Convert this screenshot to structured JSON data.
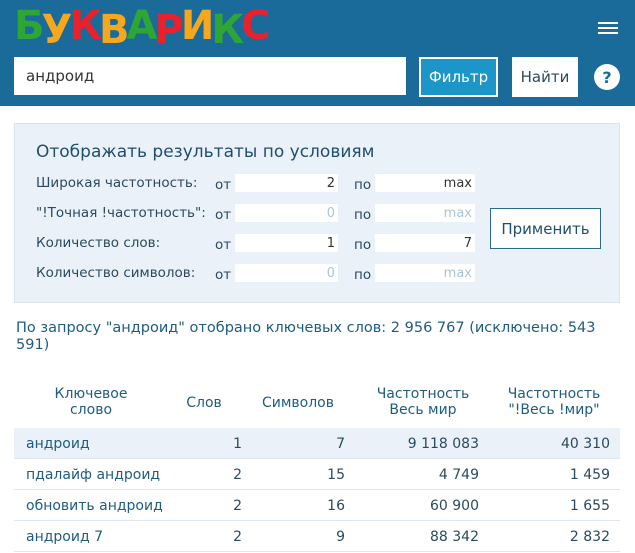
{
  "logo": {
    "letters": [
      "Б",
      "У",
      "К",
      "В",
      "А",
      "Р",
      "И",
      "К",
      "С"
    ],
    "colors": [
      "#2ea636",
      "#f7a71b",
      "#e9212d",
      "#f7a71b",
      "#2ea636",
      "#e9212d",
      "#f7a71b",
      "#2ea636",
      "#e9212d"
    ]
  },
  "header": {
    "search_value": "андроид",
    "filter_label": "Фильтр",
    "find_label": "Найти",
    "help_label": "?"
  },
  "filters": {
    "title": "Отображать результаты по условиям",
    "from": "от",
    "to": "по",
    "apply_label": "Применить",
    "rows": [
      {
        "label": "Широкая частотность:",
        "min_value": "2",
        "min_placeholder": "",
        "max_value": "max",
        "max_placeholder": ""
      },
      {
        "label": "\"!Точная !частотность\":",
        "min_value": "",
        "min_placeholder": "0",
        "max_value": "",
        "max_placeholder": "max"
      },
      {
        "label": "Количество слов:",
        "min_value": "1",
        "min_placeholder": "",
        "max_value": "7",
        "max_placeholder": ""
      },
      {
        "label": "Количество символов:",
        "min_value": "",
        "min_placeholder": "0",
        "max_value": "",
        "max_placeholder": "max"
      }
    ]
  },
  "summary": "По запросу \"андроид\" отобрано ключевых слов: 2 956 767 (исключено: 543 591)",
  "table": {
    "headers": {
      "keyword_1": "Ключевое",
      "keyword_2": "слово",
      "words": "Слов",
      "chars": "Символов",
      "freq_1": "Частотность",
      "freq_2": "Весь мир",
      "freq_exact_1": "Частотность",
      "freq_exact_2": "\"!Весь !мир\""
    },
    "rows": [
      {
        "keyword": "андроид",
        "words": "1",
        "chars": "7",
        "freq": "9 118 083",
        "freq_exact": "40 310"
      },
      {
        "keyword": "пдалайф андроид",
        "words": "2",
        "chars": "15",
        "freq": "4 749",
        "freq_exact": "1 459"
      },
      {
        "keyword": "обновить андроид",
        "words": "2",
        "chars": "16",
        "freq": "60 900",
        "freq_exact": "1 655"
      },
      {
        "keyword": "андроид 7",
        "words": "2",
        "chars": "9",
        "freq": "88 342",
        "freq_exact": "2 832"
      }
    ]
  }
}
